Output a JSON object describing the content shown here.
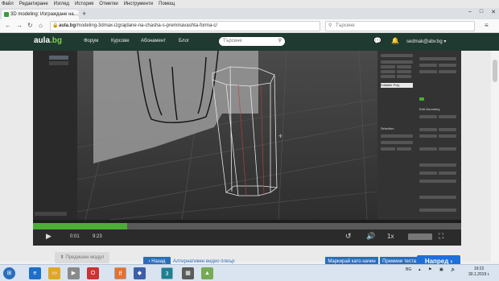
{
  "browser": {
    "menu": [
      "Файл",
      "Редактиране",
      "Изглед",
      "История",
      "Отметки",
      "Инструменти",
      "Помощ"
    ],
    "tab_title": "3D modeling: Изграждане на...",
    "url_domain": "aula.bg",
    "url_path": "/modeling-3dmax-izgrajdane-na-chasha-s-preminavashta-forma-c/",
    "search_placeholder": "Търсене"
  },
  "site": {
    "logo_main": "aula",
    "logo_dot": ".bg",
    "nav": [
      "Форум",
      "Курсове",
      "Абонамент",
      "Блог"
    ],
    "search_placeholder": "Търсене",
    "user_email": "sedmak@abv.bg"
  },
  "video": {
    "time_current": "0:01",
    "time_total": "9:23",
    "speed": "1x",
    "progress": 0.22,
    "ui_fragment_tool": "Editable Poly",
    "ui_fragment_edit_geometry": "Edit Geometry",
    "ui_fragment_selection": "Selection"
  },
  "page": {
    "prev_module": "Предишен модул",
    "back": "Назад",
    "alt_player": "Алтернативен видео плеър",
    "mark_done": "Маркирай като начин",
    "go_test": "Премини теста",
    "next": "Напред"
  },
  "taskbar": {
    "lang": "BG",
    "time": "19:22",
    "date": "30.1.2019 г."
  },
  "colors": {
    "site_header": "#1f3a30",
    "accent_green": "#4cae35",
    "accent_blue": "#2a6ebb"
  }
}
